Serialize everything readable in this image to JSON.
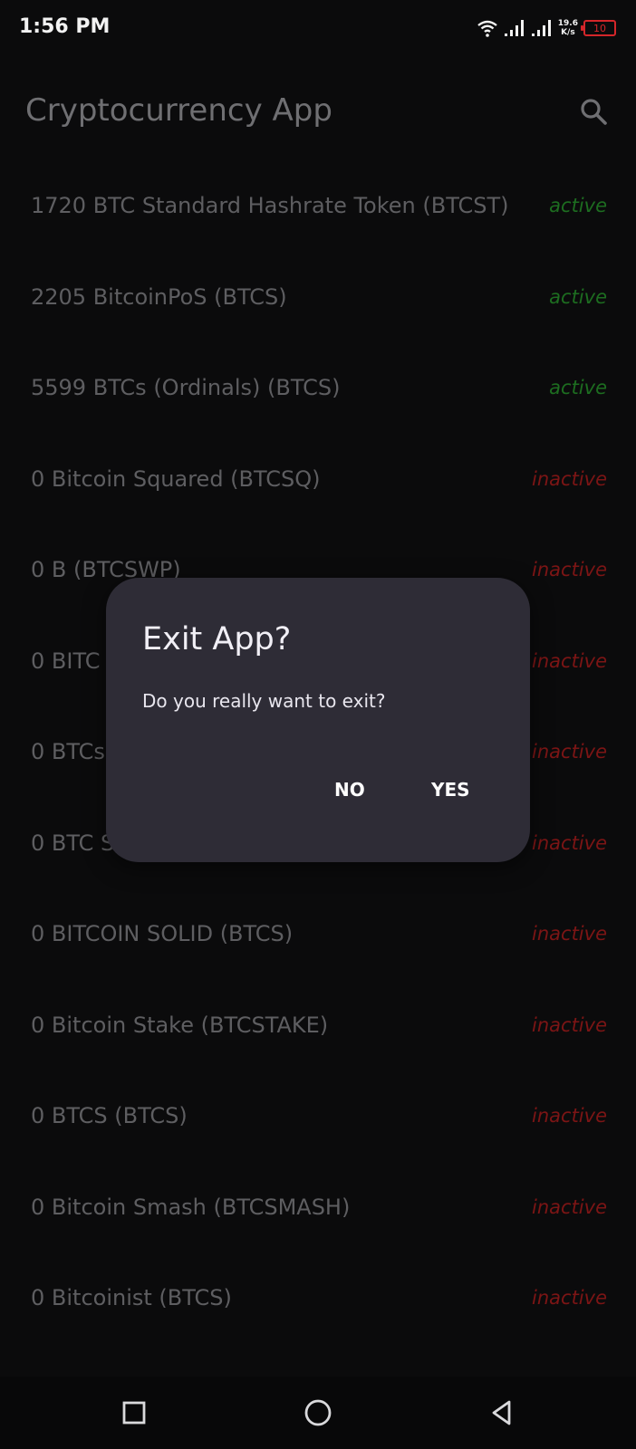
{
  "status_bar": {
    "time": "1:56 PM",
    "speed_value": "19.6",
    "speed_unit": "K/s",
    "battery": "10",
    "icons": [
      "wifi-icon",
      "signal-icon",
      "signal-icon",
      "battery-icon"
    ]
  },
  "app_bar": {
    "title": "Cryptocurrency App",
    "search_icon": "search-icon"
  },
  "list": [
    {
      "name": "1720 BTC Standard Hashrate Token (BTCST)",
      "status": "active"
    },
    {
      "name": "2205 BitcoinPoS (BTCS)",
      "status": "active"
    },
    {
      "name": "5599 BTCs (Ordinals) (BTCS)",
      "status": "active"
    },
    {
      "name": "0 Bitcoin Squared (BTCSQ)",
      "status": "inactive"
    },
    {
      "name": "0 B (BTCSWP)",
      "status": "inactive"
    },
    {
      "name": "0 BITC",
      "status": "inactive"
    },
    {
      "name": "0 BTCs",
      "status": "inactive"
    },
    {
      "name": "0 BTC S",
      "status": "inactive"
    },
    {
      "name": "0 BITCOIN SOLID (BTCS)",
      "status": "inactive"
    },
    {
      "name": "0 Bitcoin Stake (BTCSTAKE)",
      "status": "inactive"
    },
    {
      "name": "0 BTCS (BTCS)",
      "status": "inactive"
    },
    {
      "name": "0 Bitcoin Smash (BTCSMASH)",
      "status": "inactive"
    },
    {
      "name": "0 Bitcoinist (BTCS)",
      "status": "inactive"
    }
  ],
  "dialog": {
    "title": "Exit App?",
    "message": "Do you really want to exit?",
    "no_label": "NO",
    "yes_label": "YES"
  },
  "nav_bar": {
    "icons": [
      "recents-icon",
      "home-icon",
      "back-icon"
    ]
  },
  "colors": {
    "background": "#0b0b0c",
    "active": "#1d6d20",
    "inactive": "#7c1515",
    "dialog": "#2e2c36"
  }
}
